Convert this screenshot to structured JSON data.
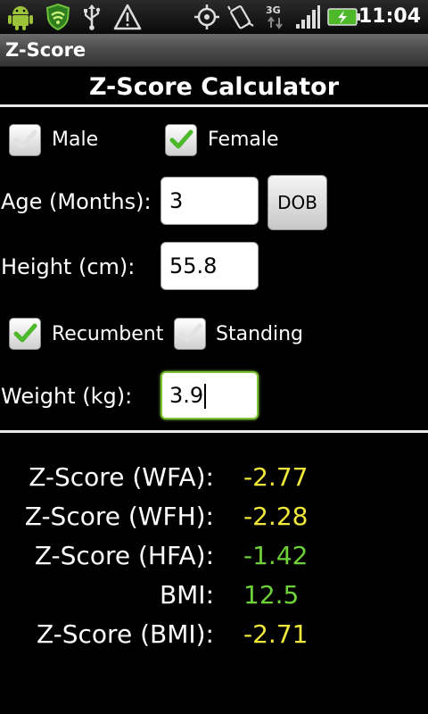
{
  "status_bar": {
    "time": "11:04",
    "network": "3G",
    "icons": [
      "android-icon",
      "shield-icon",
      "usb-icon",
      "warning-icon",
      "gps-icon",
      "rotate-icon",
      "3g-icon",
      "signal-icon",
      "battery-icon"
    ]
  },
  "app": {
    "title": "Z-Score"
  },
  "page": {
    "title": "Z-Score Calculator"
  },
  "sex": {
    "male_label": "Male",
    "male_checked": false,
    "female_label": "Female",
    "female_checked": true
  },
  "age": {
    "label": "Age (Months):",
    "value": "3",
    "dob_button": "DOB"
  },
  "height": {
    "label": "Height (cm):",
    "value": "55.8"
  },
  "measurement": {
    "recumbent_label": "Recumbent",
    "recumbent_checked": true,
    "standing_label": "Standing",
    "standing_checked": false
  },
  "weight": {
    "label": "Weight (kg):",
    "value": "3.9"
  },
  "results": [
    {
      "label": "Z-Score (WFA):",
      "value": "-2.77",
      "color": "#f0e83a"
    },
    {
      "label": "Z-Score (WFH):",
      "value": "-2.28",
      "color": "#f0e83a"
    },
    {
      "label": "Z-Score (HFA):",
      "value": "-1.42",
      "color": "#6fd13a"
    },
    {
      "label": "BMI:",
      "value": "12.5",
      "color": "#6fd13a"
    },
    {
      "label": "Z-Score (BMI):",
      "value": "-2.71",
      "color": "#f0e83a"
    }
  ],
  "colors": {
    "check_green": "#4cb82a",
    "focus_green": "#7cc434"
  }
}
